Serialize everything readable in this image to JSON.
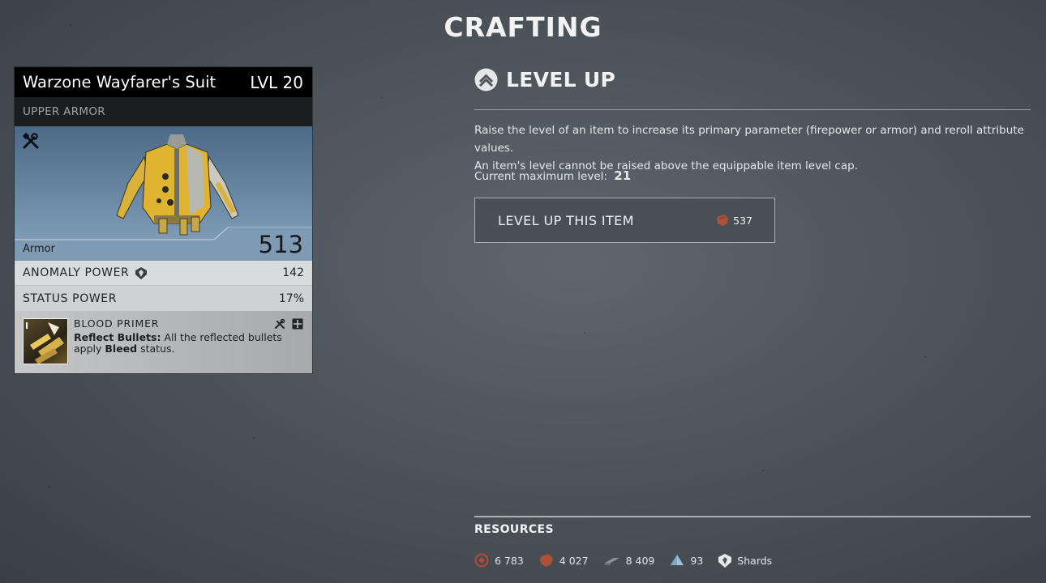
{
  "screen": {
    "title": "CRAFTING"
  },
  "item": {
    "name": "Warzone Wayfarer's Suit",
    "level": "LVL 20",
    "category": "UPPER ARMOR",
    "primary_stat_label": "Armor",
    "primary_stat_value": "513",
    "attributes": [
      {
        "name": "ANOMALY POWER",
        "value": "142",
        "icon": "anomaly-power-icon"
      },
      {
        "name": "STATUS POWER",
        "value": "17%"
      }
    ],
    "mod": {
      "slot_tag": "I",
      "name": "BLOOD PRIMER",
      "ability": "Reflect Bullets:",
      "text_before": "All the reflected bullets apply",
      "status": "Bleed",
      "text_after": "status.",
      "icons": [
        "crafted-tools-icon",
        "mod-grid-icon"
      ]
    }
  },
  "level_up": {
    "title": "LEVEL UP",
    "description_line1": "Raise the level of an item to increase its primary parameter (firepower or armor) and reroll attribute values.",
    "description_line2": "An item's level cannot be raised above the equippable item level cap.",
    "max_level_label": "Current maximum level:",
    "max_level_value": "21",
    "button_label": "LEVEL UP THIS ITEM",
    "cost": "537",
    "cost_icon": "leather-resource-icon"
  },
  "resources": {
    "title": "RESOURCES",
    "items": [
      {
        "icon": "scrap-resource-icon",
        "value": "6 783",
        "color": "#b8493a"
      },
      {
        "icon": "leather-resource-icon",
        "value": "4 027",
        "color": "#a9533a"
      },
      {
        "icon": "iron-resource-icon",
        "value": "8 409",
        "color": "#8f9498"
      },
      {
        "icon": "titanium-resource-icon",
        "value": "93",
        "color": "#9cc3dc"
      },
      {
        "icon": "shards-icon",
        "value": "Shards",
        "color": "#e6e8ea"
      }
    ]
  },
  "colors": {
    "accent_leather": "#a9533a",
    "card_art_blue": "#6b8aa6",
    "background": "#4d555b"
  }
}
